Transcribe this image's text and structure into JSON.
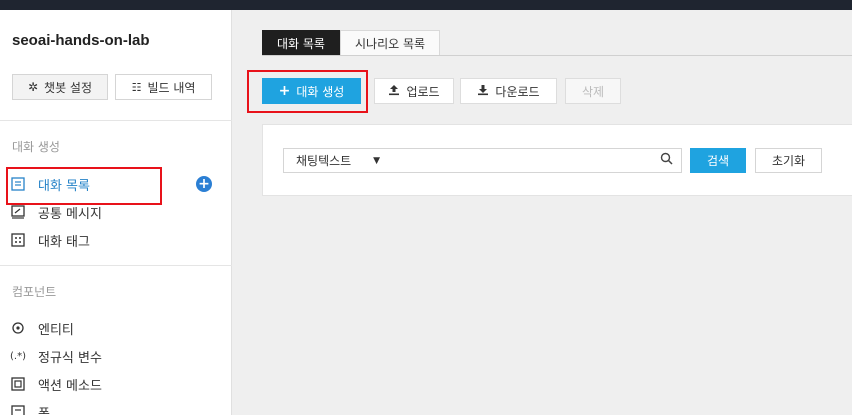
{
  "sidebar": {
    "project_name": "seoai-hands-on-lab",
    "settings_button": "챗봇 설정",
    "build_history_button": "빌드 내역",
    "section_conversation": "대화 생성",
    "items_conversation": [
      {
        "label": "대화 목록",
        "icon": "list-icon",
        "active": true
      },
      {
        "label": "공통 메시지",
        "icon": "message-icon",
        "active": false
      },
      {
        "label": "대화 태그",
        "icon": "tag-icon",
        "active": false
      }
    ],
    "section_components": "컴포넌트",
    "items_components": [
      {
        "label": "엔티티",
        "icon": "target-icon"
      },
      {
        "label": "정규식 변수",
        "icon": "regex-icon"
      },
      {
        "label": "액션 메소드",
        "icon": "action-icon"
      },
      {
        "label": "폼",
        "icon": "form-icon"
      }
    ]
  },
  "tabs": [
    {
      "label": "대화 목록",
      "active": true
    },
    {
      "label": "시나리오 목록",
      "active": false
    }
  ],
  "toolbar": {
    "create_label": "대화 생성",
    "upload_label": "업로드",
    "download_label": "다운로드",
    "delete_label": "삭제"
  },
  "search": {
    "field_selected": "채팅텍스트",
    "query_value": "",
    "search_label": "검색",
    "reset_label": "초기화"
  },
  "colors": {
    "accent": "#1fa3e0",
    "active_nav": "#2683c8",
    "highlight": "#e8121a"
  }
}
